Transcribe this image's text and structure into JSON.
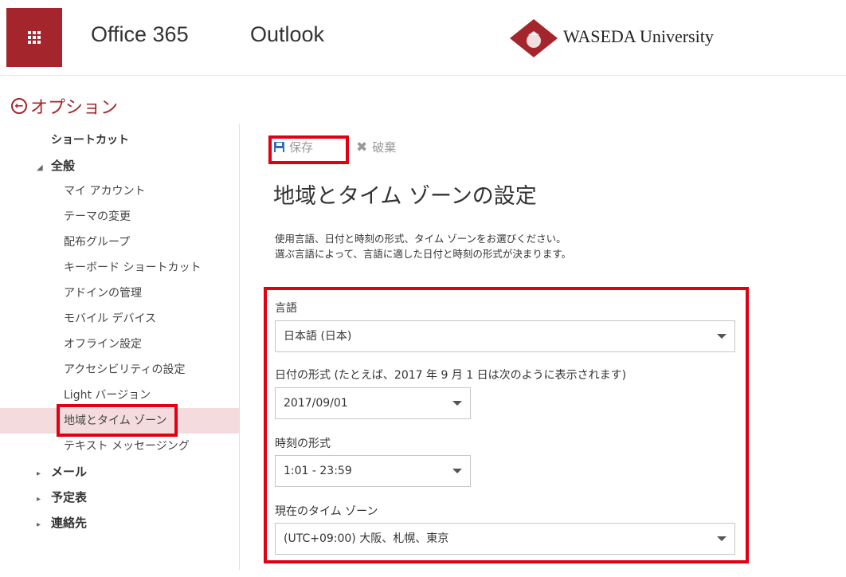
{
  "topbar": {
    "brand": "Office 365",
    "app": "Outlook",
    "university": "WASEDA University",
    "accent_color": "#a4262c"
  },
  "options": {
    "title": "オプション"
  },
  "nav": {
    "shortcuts": "ショートカット",
    "general": "全般",
    "general_items": [
      "マイ アカウント",
      "テーマの変更",
      "配布グループ",
      "キーボード ショートカット",
      "アドインの管理",
      "モバイル デバイス",
      "オフライン設定",
      "アクセシビリティの設定",
      "Light バージョン",
      "地域とタイム ゾーン",
      "テキスト メッセージング"
    ],
    "mail": "メール",
    "calendar": "予定表",
    "contacts": "連絡先"
  },
  "toolbar": {
    "save_label": "保存",
    "discard_label": "破棄"
  },
  "page": {
    "title": "地域とタイム ゾーンの設定",
    "desc_line1": "使用言語、日付と時刻の形式、タイム ゾーンをお選びください。",
    "desc_line2": "選ぶ言語によって、言語に適した日付と時刻の形式が決まります。"
  },
  "form": {
    "language_label": "言語",
    "language_value": "日本語 (日本)",
    "date_label": "日付の形式 (たとえば、2017 年 9 月 1 日は次のように表示されます)",
    "date_value": "2017/09/01",
    "time_label": "時刻の形式",
    "time_value": "1:01 - 23:59",
    "timezone_label": "現在のタイム ゾーン",
    "timezone_value": "(UTC+09:00) 大阪、札幌、東京"
  }
}
